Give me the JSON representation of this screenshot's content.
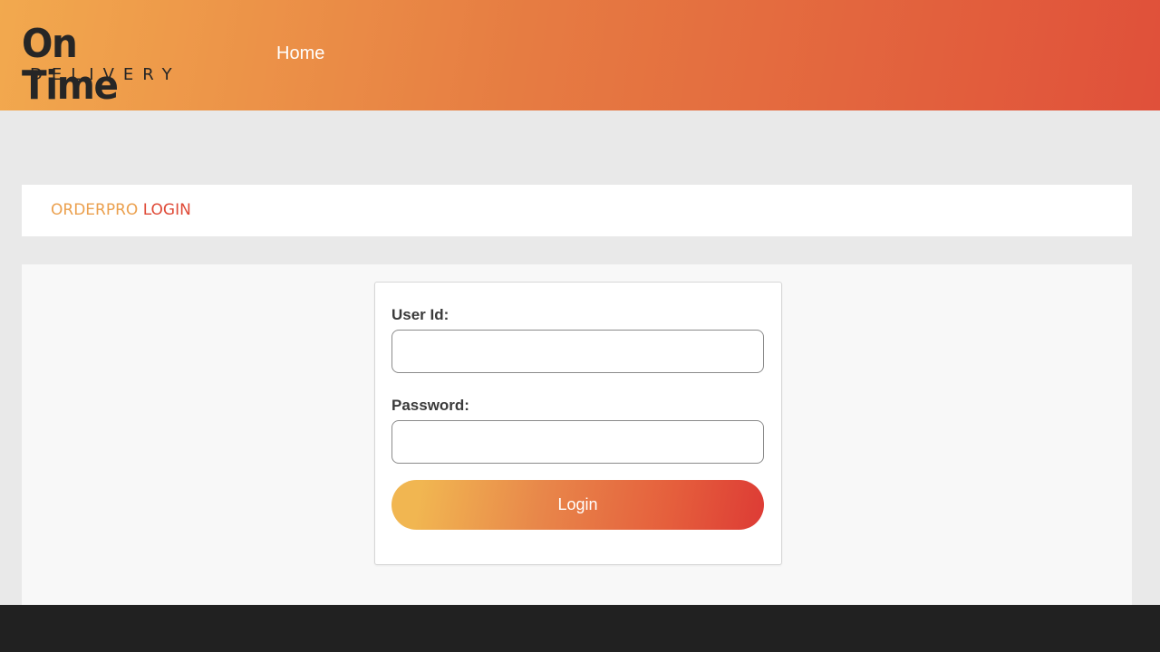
{
  "header": {
    "logo": {
      "title": "On Time",
      "subtitle": "DELIVERY"
    },
    "nav": {
      "home_label": "Home"
    }
  },
  "page_title": {
    "part1": "ORDERPRO",
    "part2": "LOGIN"
  },
  "login_form": {
    "user_id": {
      "label": "User Id:",
      "value": ""
    },
    "password": {
      "label": "Password:",
      "value": ""
    },
    "submit_label": "Login"
  },
  "colors": {
    "header_gradient_start": "#f2a94e",
    "header_gradient_end": "#e0503a",
    "title_accent_1": "#eba04e",
    "title_accent_2": "#df4a37",
    "footer": "#212121"
  }
}
